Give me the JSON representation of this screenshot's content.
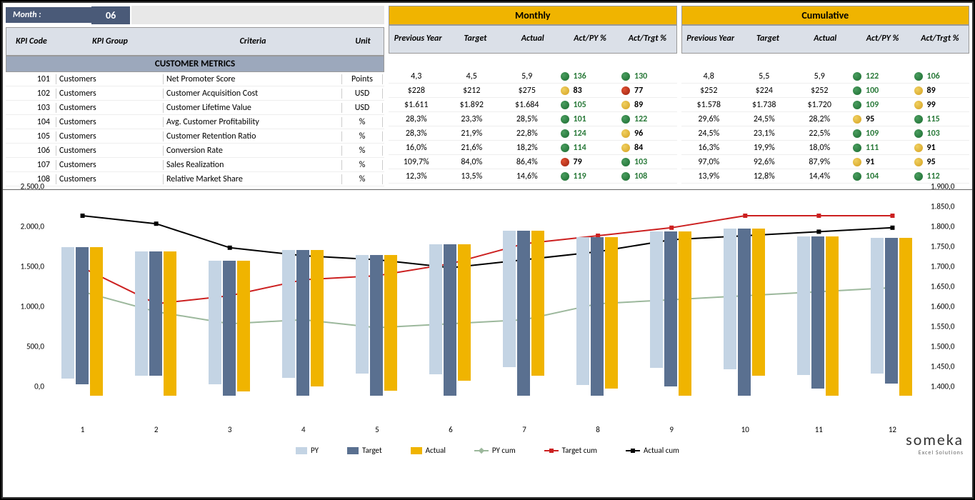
{
  "month_label": "Month :",
  "month_value": "06",
  "headers": {
    "kpi_code": "KPI Code",
    "kpi_group": "KPI Group",
    "criteria": "Criteria",
    "unit": "Unit"
  },
  "monthly_title": "Monthly",
  "cumulative_title": "Cumulative",
  "sub_headers": {
    "py": "Previous Year",
    "target": "Target",
    "actual": "Actual",
    "act_py": "Act/PY %",
    "act_trgt": "Act/Trgt %"
  },
  "section_title": "CUSTOMER METRICS",
  "rows": [
    {
      "code": "101",
      "group": "Customers",
      "criteria": "Net Promoter Score",
      "unit": "Points",
      "m": {
        "py": "4,3",
        "target": "4,5",
        "actual": "5,9",
        "act_py": {
          "v": "136",
          "c": "green"
        },
        "act_trgt": {
          "v": "130",
          "c": "green"
        }
      },
      "c": {
        "py": "4,8",
        "target": "5,5",
        "actual": "5,9",
        "act_py": {
          "v": "122",
          "c": "green"
        },
        "act_trgt": {
          "v": "106",
          "c": "green"
        }
      }
    },
    {
      "code": "102",
      "group": "Customers",
      "criteria": "Customer Acquisition Cost",
      "unit": "USD",
      "m": {
        "py": "$228",
        "target": "$212",
        "actual": "$275",
        "act_py": {
          "v": "83",
          "c": "yellow"
        },
        "act_trgt": {
          "v": "77",
          "c": "red"
        }
      },
      "c": {
        "py": "$252",
        "target": "$224",
        "actual": "$252",
        "act_py": {
          "v": "100",
          "c": "green"
        },
        "act_trgt": {
          "v": "89",
          "c": "yellow"
        }
      }
    },
    {
      "code": "103",
      "group": "Customers",
      "criteria": "Customer Lifetime Value",
      "unit": "USD",
      "m": {
        "py": "$1.611",
        "target": "$1.892",
        "actual": "$1.684",
        "act_py": {
          "v": "105",
          "c": "green"
        },
        "act_trgt": {
          "v": "89",
          "c": "yellow"
        }
      },
      "c": {
        "py": "$1.578",
        "target": "$1.738",
        "actual": "$1.720",
        "act_py": {
          "v": "109",
          "c": "green"
        },
        "act_trgt": {
          "v": "99",
          "c": "yellow"
        }
      }
    },
    {
      "code": "104",
      "group": "Customers",
      "criteria": "Avg. Customer Profitability",
      "unit": "%",
      "m": {
        "py": "28,3%",
        "target": "23,3%",
        "actual": "28,5%",
        "act_py": {
          "v": "101",
          "c": "green"
        },
        "act_trgt": {
          "v": "122",
          "c": "green"
        }
      },
      "c": {
        "py": "29,6%",
        "target": "24,5%",
        "actual": "28,2%",
        "act_py": {
          "v": "95",
          "c": "yellow"
        },
        "act_trgt": {
          "v": "115",
          "c": "green"
        }
      }
    },
    {
      "code": "105",
      "group": "Customers",
      "criteria": "Customer Retention Ratio",
      "unit": "%",
      "m": {
        "py": "28,3%",
        "target": "21,9%",
        "actual": "22,8%",
        "act_py": {
          "v": "124",
          "c": "green"
        },
        "act_trgt": {
          "v": "96",
          "c": "yellow"
        }
      },
      "c": {
        "py": "24,5%",
        "target": "23,1%",
        "actual": "22,5%",
        "act_py": {
          "v": "109",
          "c": "green"
        },
        "act_trgt": {
          "v": "103",
          "c": "green"
        }
      }
    },
    {
      "code": "106",
      "group": "Customers",
      "criteria": "Conversion Rate",
      "unit": "%",
      "m": {
        "py": "16,0%",
        "target": "21,6%",
        "actual": "18,2%",
        "act_py": {
          "v": "114",
          "c": "green"
        },
        "act_trgt": {
          "v": "84",
          "c": "yellow"
        }
      },
      "c": {
        "py": "16,3%",
        "target": "19,9%",
        "actual": "18,0%",
        "act_py": {
          "v": "111",
          "c": "green"
        },
        "act_trgt": {
          "v": "91",
          "c": "yellow"
        }
      }
    },
    {
      "code": "107",
      "group": "Customers",
      "criteria": "Sales Realization",
      "unit": "%",
      "m": {
        "py": "109,7%",
        "target": "84,0%",
        "actual": "86,4%",
        "act_py": {
          "v": "79",
          "c": "red"
        },
        "act_trgt": {
          "v": "103",
          "c": "green"
        }
      },
      "c": {
        "py": "97,0%",
        "target": "92,6%",
        "actual": "87,9%",
        "act_py": {
          "v": "91",
          "c": "yellow"
        },
        "act_trgt": {
          "v": "95",
          "c": "yellow"
        }
      }
    },
    {
      "code": "108",
      "group": "Customers",
      "criteria": "Relative Market Share",
      "unit": "%",
      "m": {
        "py": "12,3%",
        "target": "13,5%",
        "actual": "14,6%",
        "act_py": {
          "v": "119",
          "c": "green"
        },
        "act_trgt": {
          "v": "108",
          "c": "green"
        }
      },
      "c": {
        "py": "13,9%",
        "target": "12,8%",
        "actual": "14,4%",
        "act_py": {
          "v": "104",
          "c": "green"
        },
        "act_trgt": {
          "v": "112",
          "c": "green"
        }
      }
    }
  ],
  "chart_data": {
    "type": "bar",
    "categories": [
      "1",
      "2",
      "3",
      "4",
      "5",
      "6",
      "7",
      "8",
      "9",
      "10",
      "11",
      "12"
    ],
    "y_left": {
      "min": 0,
      "max": 2500,
      "ticks": [
        "0,0",
        "500,0",
        "1.000,0",
        "1.500,0",
        "2.000,0",
        "2.500,0"
      ]
    },
    "y_right": {
      "min": 1400,
      "max": 1900,
      "ticks": [
        "1.400,0",
        "1.450,0",
        "1.500,0",
        "1.550,0",
        "1.600,0",
        "1.650,0",
        "1.700,0",
        "1.750,0",
        "1.800,0",
        "1.850,0",
        "1.900,0"
      ]
    },
    "series_bars": [
      {
        "name": "PY",
        "color": "#c4d4e4",
        "values": [
          1650,
          1550,
          1550,
          1600,
          1480,
          1620,
          1700,
          1850,
          1700,
          1760,
          1730,
          1690
        ]
      },
      {
        "name": "Target",
        "color": "#5a7090",
        "values": [
          1720,
          1550,
          1690,
          1820,
          1760,
          1890,
          2060,
          1980,
          1930,
          2090,
          1900,
          1820
        ]
      },
      {
        "name": "Actual",
        "color": "#f0b400",
        "values": [
          1860,
          1800,
          1640,
          1700,
          1700,
          1700,
          1810,
          1890,
          2050,
          1840,
          1990,
          1970
        ]
      }
    ],
    "series_lines_right": [
      {
        "name": "PY cum",
        "color": "#9cb89c",
        "values": [
          1660,
          1610,
          1580,
          1590,
          1570,
          1580,
          1590,
          1630,
          1640,
          1650,
          1660,
          1670
        ]
      },
      {
        "name": "Target cum",
        "color": "#cc2020",
        "values": [
          1720,
          1630,
          1650,
          1690,
          1700,
          1730,
          1780,
          1800,
          1820,
          1850,
          1850,
          1850
        ]
      },
      {
        "name": "Actual cum",
        "color": "#000000",
        "values": [
          1850,
          1830,
          1770,
          1750,
          1740,
          1720,
          1740,
          1760,
          1790,
          1800,
          1810,
          1820
        ]
      }
    ],
    "legend": [
      "PY",
      "Target",
      "Actual",
      "PY cum",
      "Target cum",
      "Actual cum"
    ]
  },
  "logo": {
    "main": "someka",
    "sub": "Excel Solutions"
  }
}
